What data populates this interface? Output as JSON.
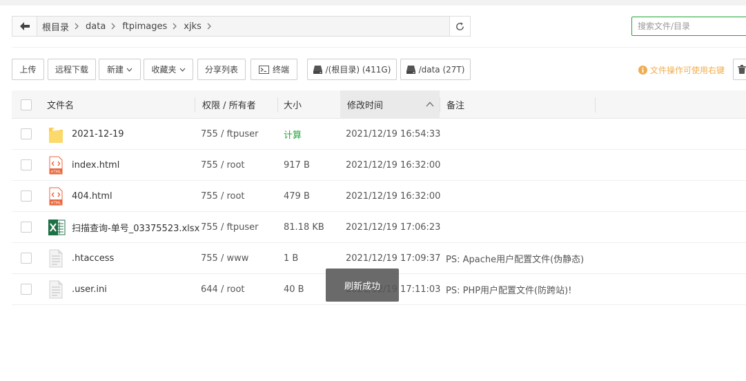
{
  "breadcrumb": [
    "根目录",
    "data",
    "ftpimages",
    "xjks"
  ],
  "search": {
    "placeholder": "搜索文件/目录"
  },
  "toolbar": {
    "upload": "上传",
    "remote_download": "远程下载",
    "new": "新建",
    "favorites": "收藏夹",
    "share_list": "分享列表",
    "terminal": "终端",
    "disk_root": "/(根目录) (411G)",
    "disk_data": "/data (27T)",
    "tip": "文件操作可使用右键"
  },
  "table": {
    "headers": {
      "name": "文件名",
      "perm": "权限 / 所有者",
      "size": "大小",
      "mtime": "修改时间",
      "note": "备注"
    },
    "rows": [
      {
        "icon": "folder-icon",
        "name": "2021-12-19",
        "perm": "755 / ftpuser",
        "size": "计算",
        "mtime": "2021/12/19 16:54:33",
        "note": ""
      },
      {
        "icon": "html-file-icon",
        "name": "index.html",
        "perm": "755 / root",
        "size": "917 B",
        "mtime": "2021/12/19 16:32:00",
        "note": ""
      },
      {
        "icon": "html-file-icon",
        "name": "404.html",
        "perm": "755 / root",
        "size": "479 B",
        "mtime": "2021/12/19 16:32:00",
        "note": ""
      },
      {
        "icon": "excel-file-icon",
        "name": "扫描查询-单号_03375523.xlsx",
        "perm": "755 / ftpuser",
        "size": "81.18 KB",
        "mtime": "2021/12/19 17:06:23",
        "note": ""
      },
      {
        "icon": "text-file-icon",
        "name": ".htaccess",
        "perm": "755 / www",
        "size": "1 B",
        "mtime": "2021/12/19 17:09:37",
        "note": "PS: Apache用户配置文件(伪静态)"
      },
      {
        "icon": "text-file-icon",
        "name": ".user.ini",
        "perm": "644 / root",
        "size": "40 B",
        "mtime": "2021/12/19 17:11:03",
        "note": "PS: PHP用户配置文件(防跨站)!"
      }
    ]
  },
  "toast": "刷新成功",
  "colors": {
    "accent": "#20a53a",
    "warning": "#f0ad4e",
    "folder": "#f9cc52",
    "html": "#e8663c",
    "excel": "#1e7145"
  }
}
